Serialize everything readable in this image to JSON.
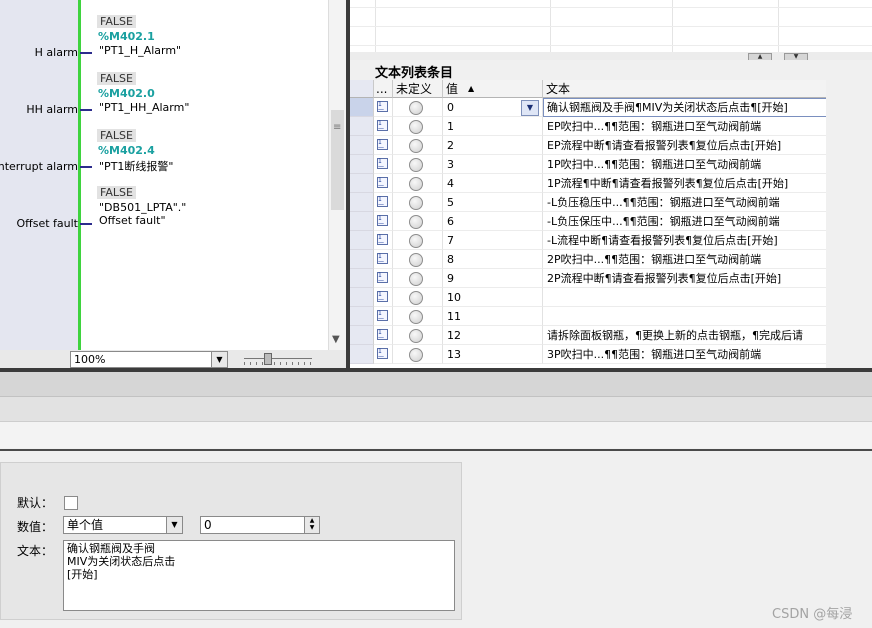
{
  "ladder": {
    "pins": [
      {
        "label": "H alarm",
        "state": "FALSE",
        "address": "%M402.1",
        "tag": "\"PT1_H_Alarm\""
      },
      {
        "label": "HH alarm",
        "state": "FALSE",
        "address": "%M402.0",
        "tag": "\"PT1_HH_Alarm\""
      },
      {
        "label": "Interrupt alarm",
        "state": "FALSE",
        "address": "%M402.4",
        "tag": "\"PT1断线报警\""
      },
      {
        "label": "Offset fault",
        "state": "FALSE",
        "address": "",
        "tag": "\"DB501_LPTA\".\"",
        "tag2": "Offset fault\""
      }
    ],
    "zoom": "100%"
  },
  "text_list": {
    "title": "文本列表条目",
    "columns": {
      "dots": "...",
      "undefined": "未定义",
      "value": "值",
      "text": "文本"
    },
    "rows": [
      {
        "value": "0",
        "text": "确认钢瓶阀及手阀¶MIV为关闭状态后点击¶[开始]"
      },
      {
        "value": "1",
        "text": "EP吹扫中...¶¶范围：钢瓶进口至气动阀前端"
      },
      {
        "value": "2",
        "text": "EP流程中断¶请查看报警列表¶复位后点击[开始]"
      },
      {
        "value": "3",
        "text": "1P吹扫中...¶¶范围：钢瓶进口至气动阀前端"
      },
      {
        "value": "4",
        "text": "1P流程¶中断¶请查看报警列表¶复位后点击[开始]"
      },
      {
        "value": "5",
        "text": "-L负压稳压中...¶¶范围：钢瓶进口至气动阀前端"
      },
      {
        "value": "6",
        "text": "-L负压保压中...¶¶范围：钢瓶进口至气动阀前端"
      },
      {
        "value": "7",
        "text": "-L流程中断¶请查看报警列表¶复位后点击[开始]"
      },
      {
        "value": "8",
        "text": "2P吹扫中...¶¶范围：钢瓶进口至气动阀前端"
      },
      {
        "value": "9",
        "text": "2P流程中断¶请查看报警列表¶复位后点击[开始]"
      },
      {
        "value": "10",
        "text": ""
      },
      {
        "value": "11",
        "text": ""
      },
      {
        "value": "12",
        "text": "请拆除面板钢瓶，¶更换上新的点击钢瓶，¶完成后请"
      },
      {
        "value": "13",
        "text": "3P吹扫中...¶¶范围：钢瓶进口至气动阀前端"
      }
    ]
  },
  "properties": {
    "default_label": "默认：",
    "value_label": "数值：",
    "value_mode": "单个值",
    "value_input": "0",
    "text_label": "文本：",
    "text_lines": [
      "确认钢瓶阀及手阀",
      "MIV为关闭状态后点击",
      "[开始]"
    ]
  },
  "watermark": "CSDN @每浸"
}
